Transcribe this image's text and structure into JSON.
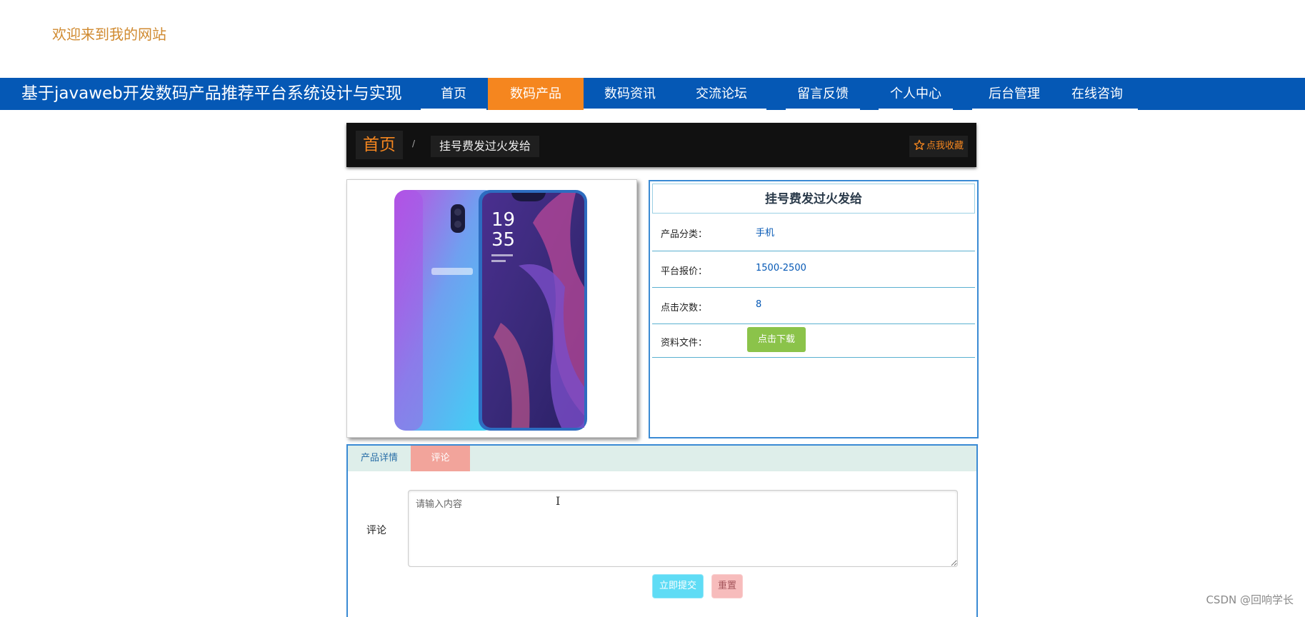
{
  "header": {
    "welcome": "欢迎来到我的网站"
  },
  "navbar": {
    "site_title": "基于javaweb开发数码产品推荐平台系统设计与实现",
    "items": [
      {
        "label": "首页"
      },
      {
        "label": "数码产品",
        "active": true
      },
      {
        "label": "数码资讯"
      },
      {
        "label": "交流论坛"
      },
      {
        "label": "留言反馈"
      },
      {
        "label": "个人中心"
      },
      {
        "label": "后台管理"
      },
      {
        "label": "在线咨询"
      }
    ]
  },
  "breadcrumb": {
    "home": "首页",
    "separator": "/",
    "current": "挂号费发过火发给",
    "favorite": "点我收藏"
  },
  "product": {
    "title": "挂号费发过火发给",
    "rows": [
      {
        "label": "产品分类：",
        "value": "手机"
      },
      {
        "label": "平台报价：",
        "value": "1500-2500"
      },
      {
        "label": "点击次数：",
        "value": "8"
      },
      {
        "label": "资料文件：",
        "button": "点击下载"
      }
    ],
    "image_icon": "phone-product-image"
  },
  "tabs": {
    "detail": "产品详情",
    "comment": "评论"
  },
  "comment_form": {
    "label": "评论",
    "placeholder": "请输入内容",
    "cursor": "I",
    "submit": "立即提交",
    "reset": "重置"
  },
  "watermark": "CSDN @回响学长",
  "colors": {
    "nav_bg": "#0558b5",
    "accent": "#f5861f",
    "info_border": "#3a8ad4",
    "download_btn": "#8bc34a",
    "tab_active": "#f2a49b"
  }
}
